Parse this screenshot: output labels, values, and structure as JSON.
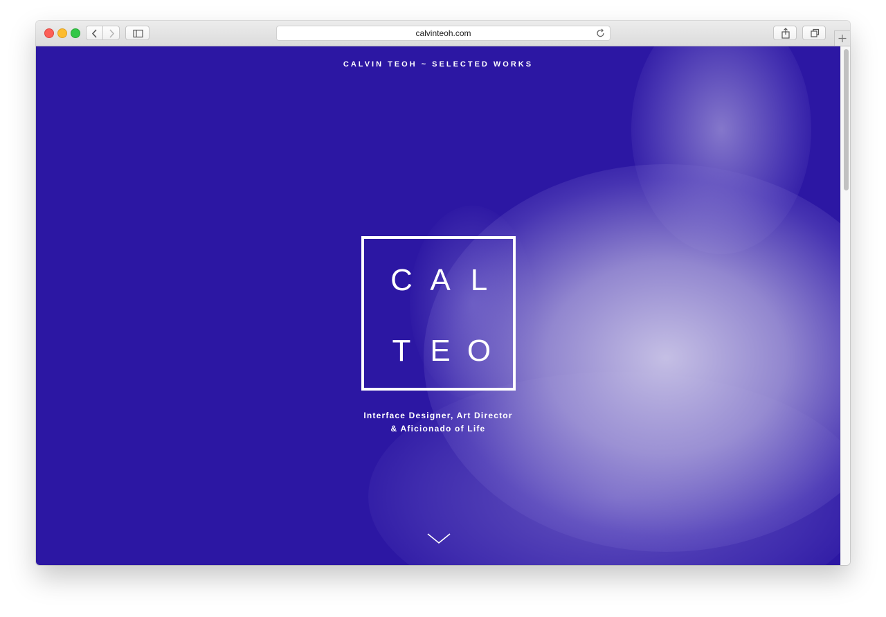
{
  "browser": {
    "url": "calvinteoh.com"
  },
  "page": {
    "header": "CALVIN TEOH ~ SELECTED WORKS",
    "logo": {
      "row1": [
        "C",
        "A",
        "L"
      ],
      "row2": [
        "T",
        "E",
        "O"
      ]
    },
    "tagline_line1": "Interface Designer, Art Director",
    "tagline_line2": "& Aficionado of Life",
    "icons": {
      "scroll": "chevron-down-icon"
    }
  },
  "colors": {
    "background": "#2c17a3",
    "text": "#ffffff",
    "glow": "#c8c2e6"
  }
}
